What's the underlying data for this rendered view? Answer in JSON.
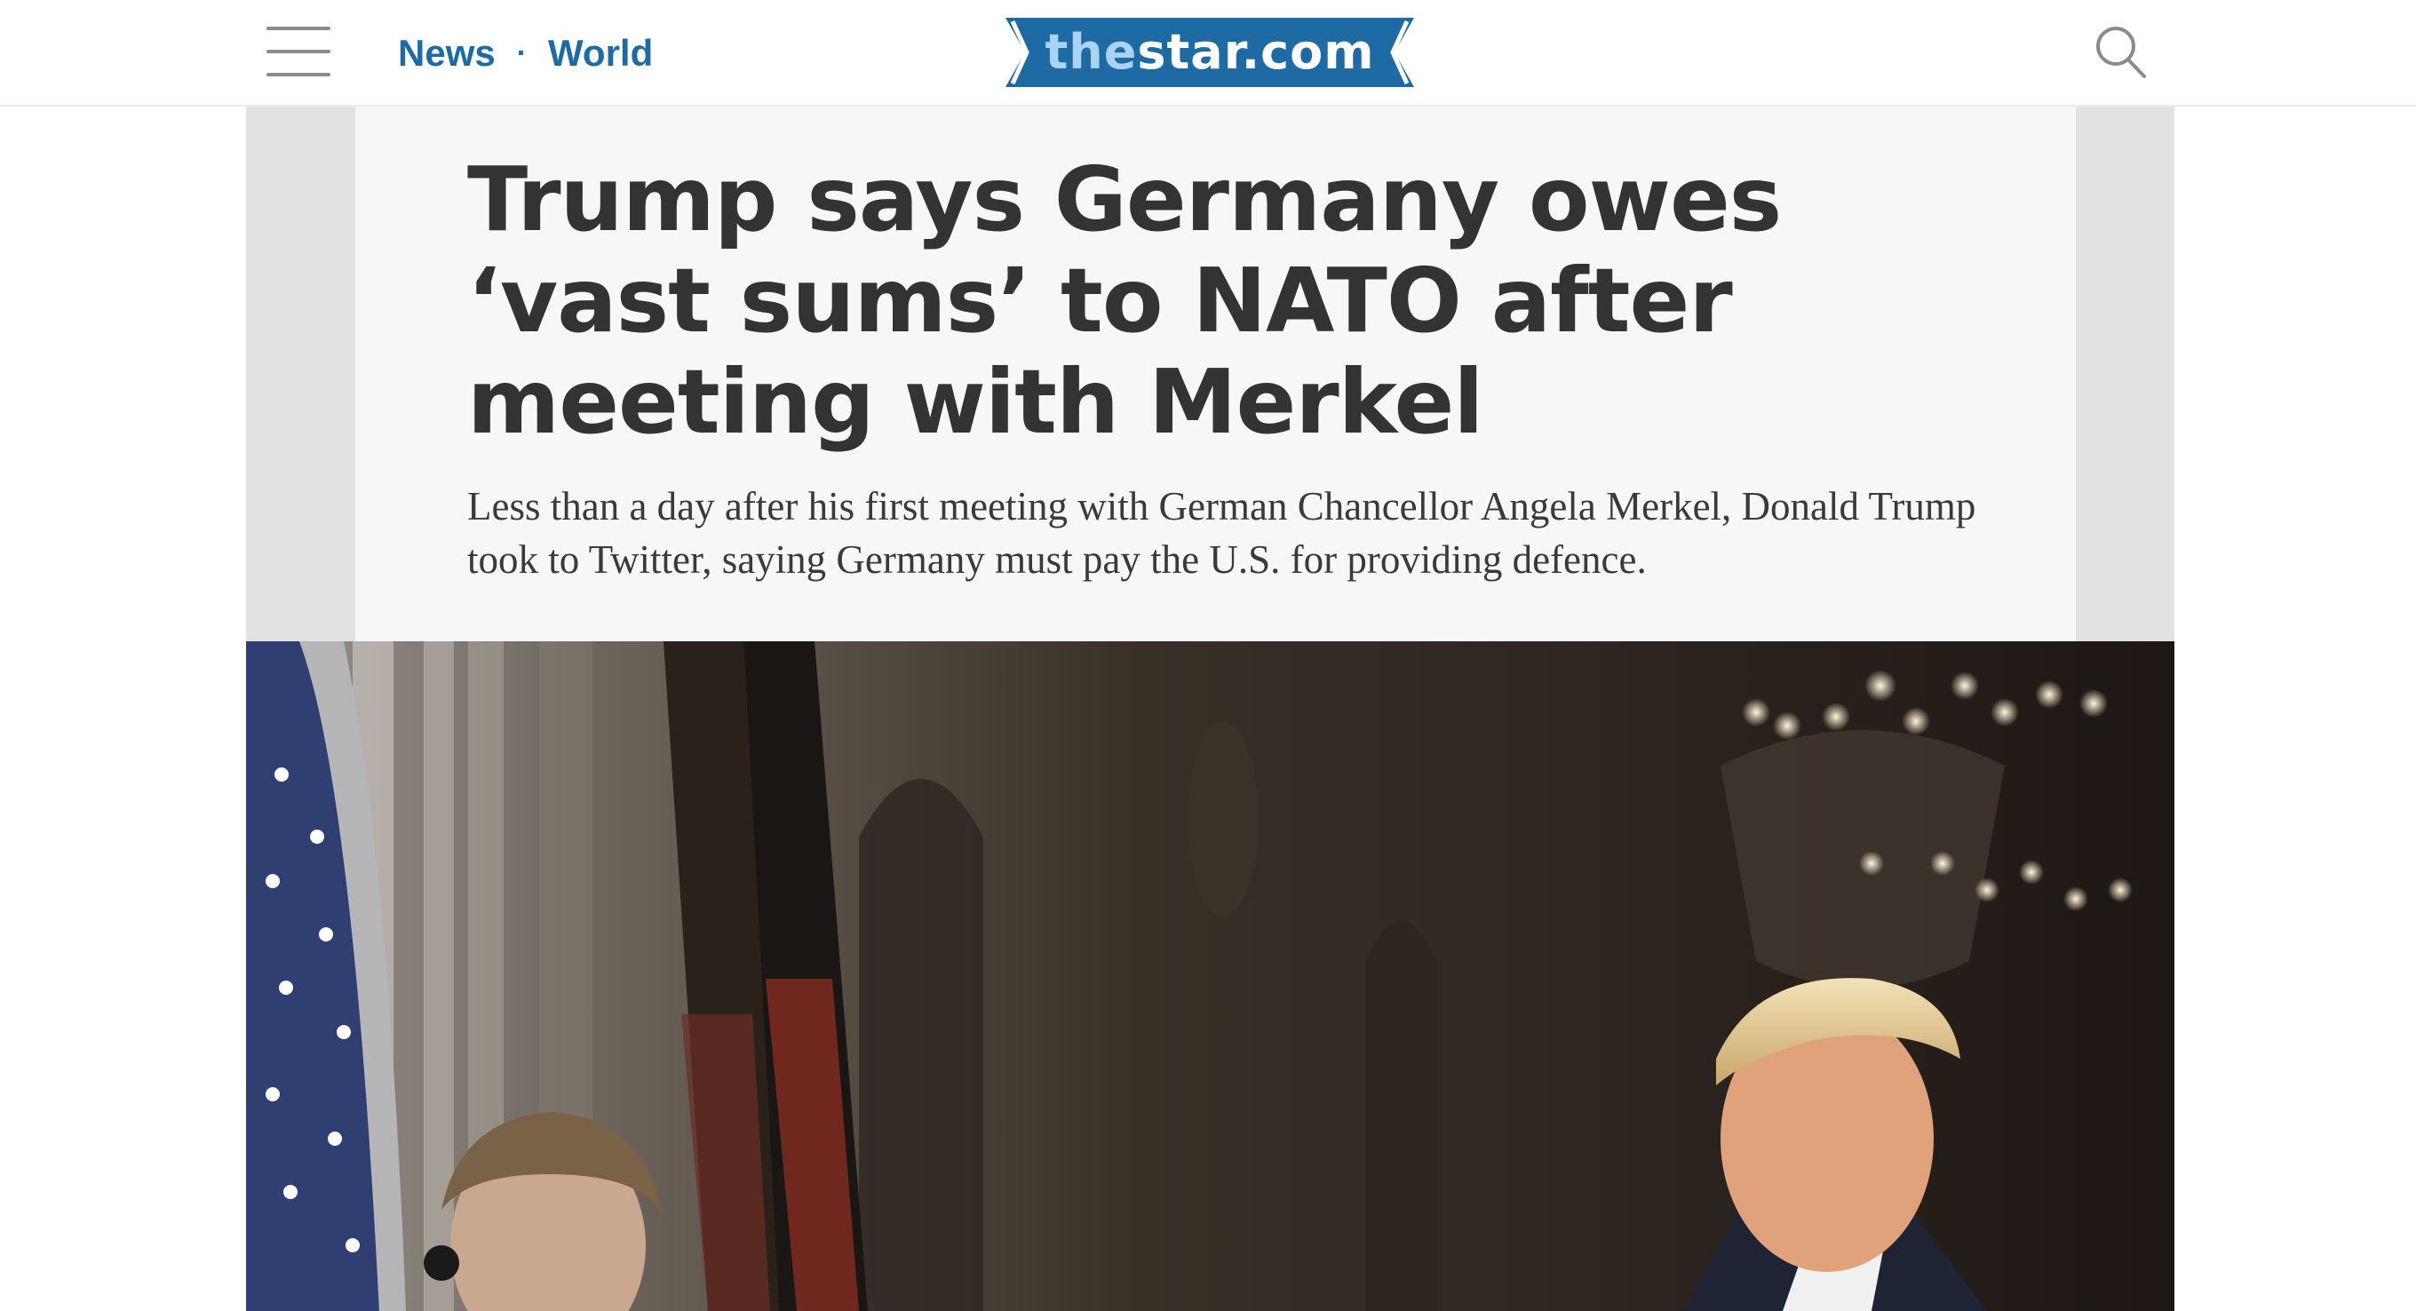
{
  "header": {
    "breadcrumb": [
      {
        "label": "News"
      },
      {
        "label": "World"
      }
    ],
    "breadcrumb_separator": "·",
    "logo": {
      "prefix": "the",
      "main": "star.com"
    },
    "colors": {
      "brand_blue": "#1d6aa5",
      "link": "#1d6aa5"
    }
  },
  "article": {
    "headline": "Trump says Germany owes ‘vast sums’ to NATO after meeting with Merkel",
    "dek": "Less than a day after his first meeting with German Chancellor Angela Merkel, Donald Trump took to Twitter, saying Germany must pay the U.S. for providing defence."
  },
  "icons": {
    "menu": "hamburger-menu-icon",
    "search": "search-icon"
  }
}
